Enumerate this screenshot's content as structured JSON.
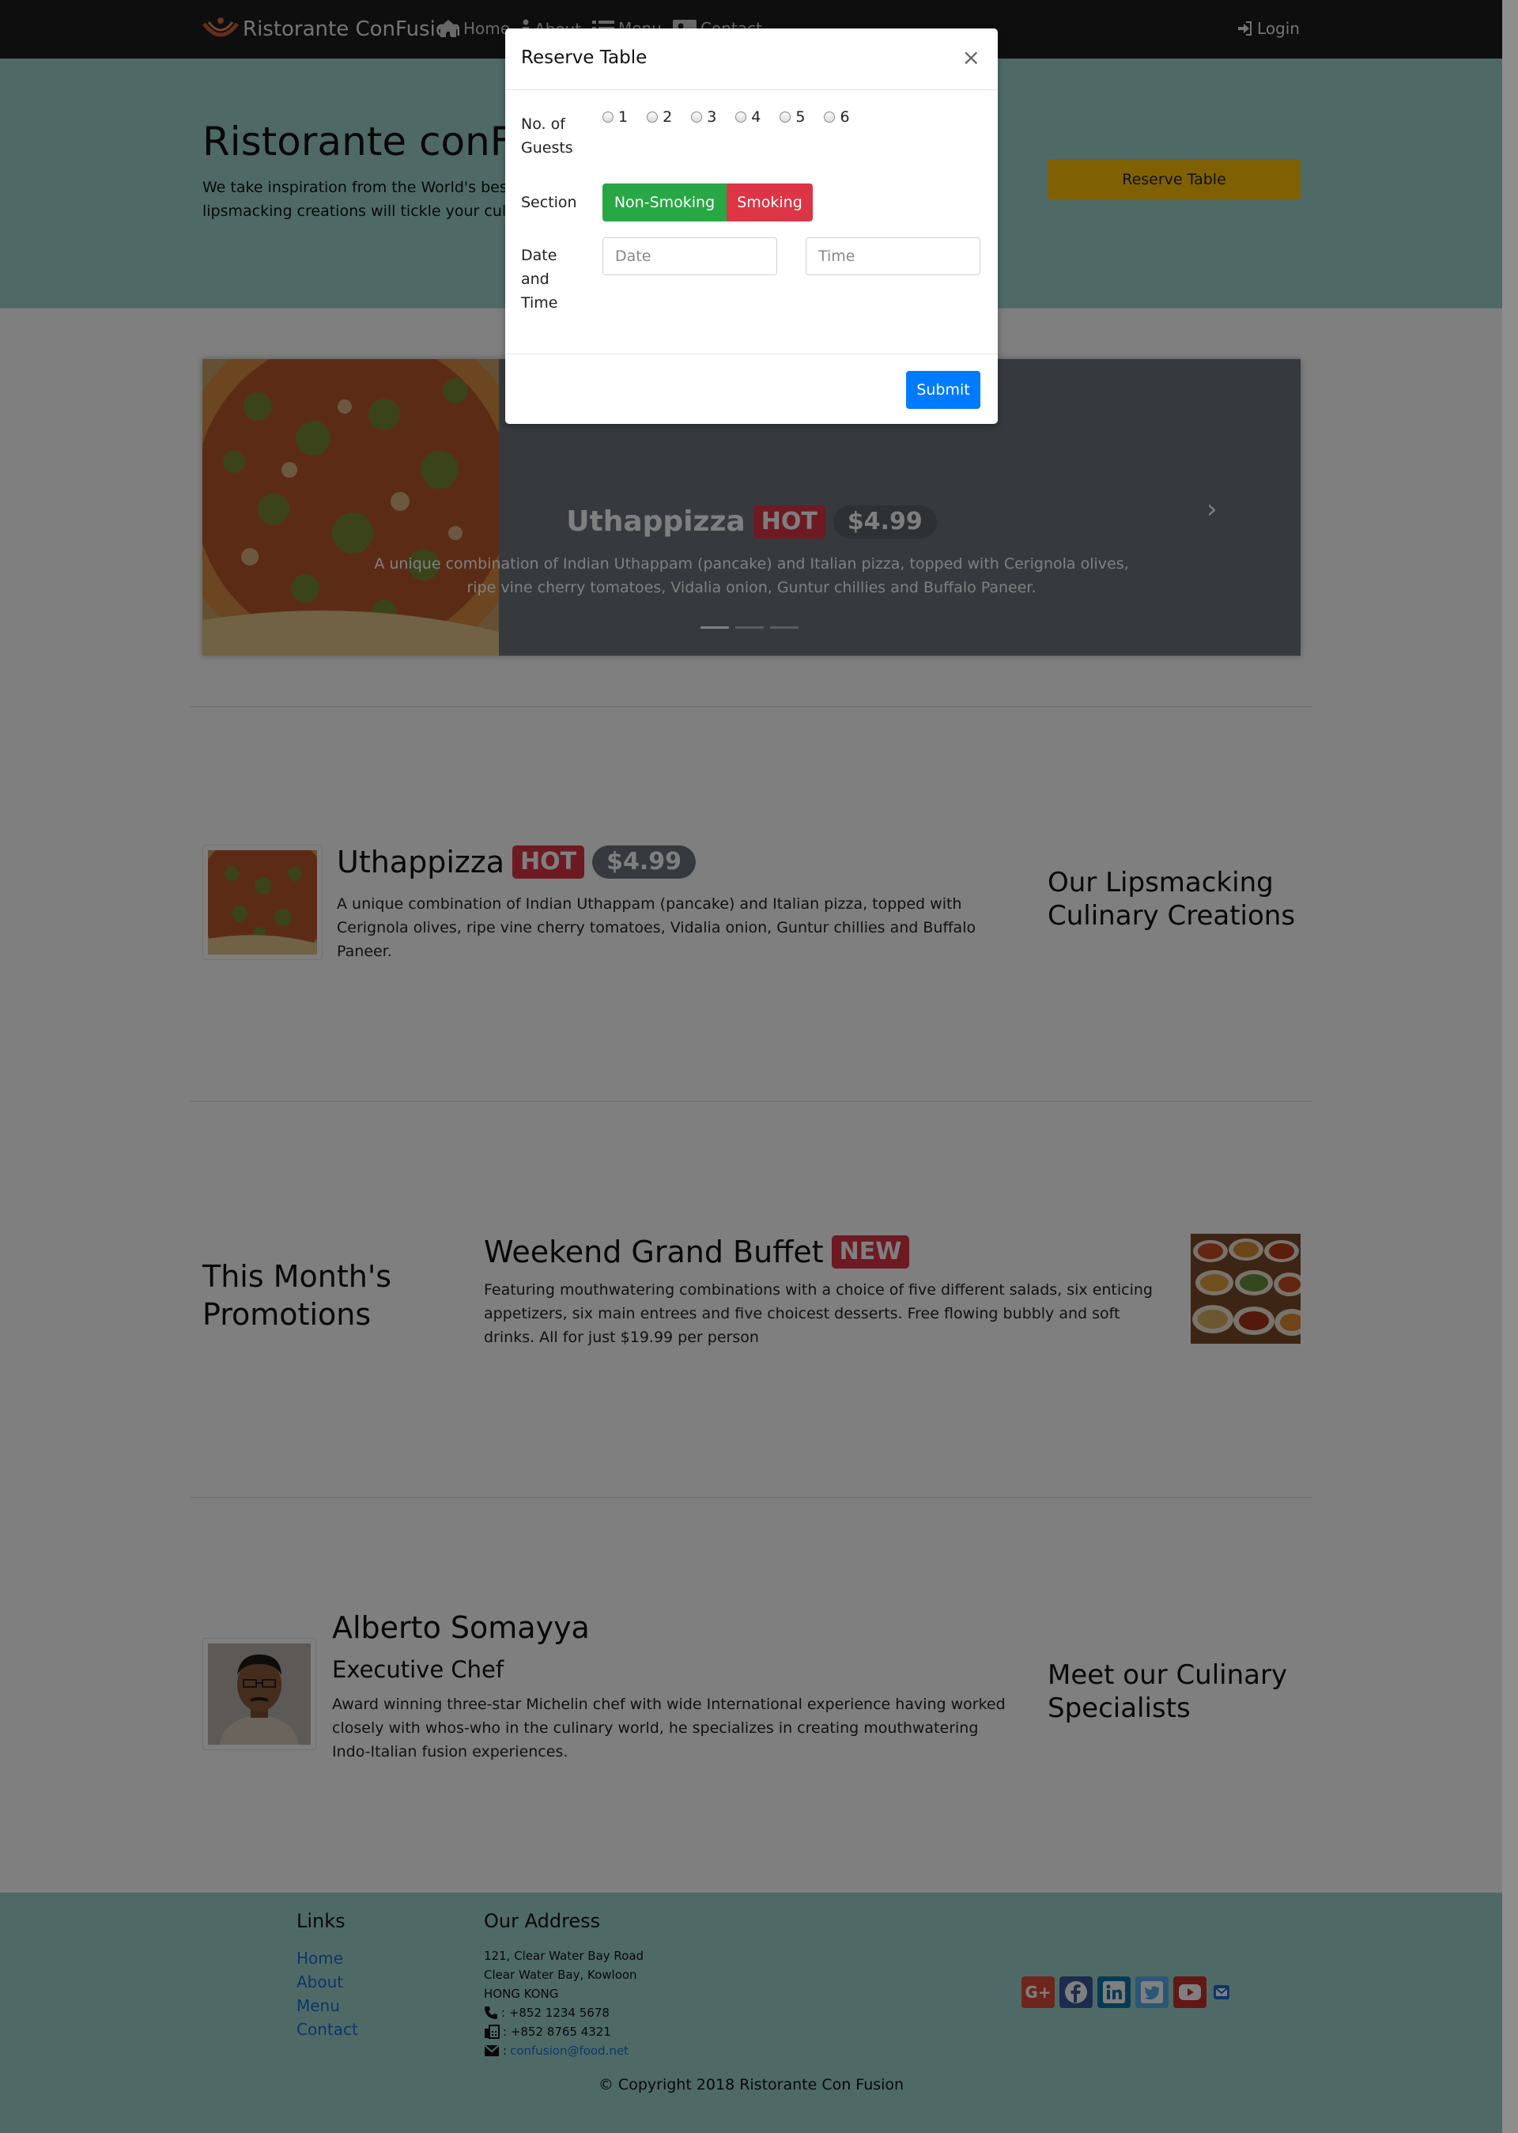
{
  "navbar": {
    "brand": "Ristorante ConFusion",
    "items": [
      {
        "label": "Home",
        "icon": "home-icon"
      },
      {
        "label": "About",
        "icon": "info-icon"
      },
      {
        "label": "Menu",
        "icon": "list-icon"
      },
      {
        "label": "Contact",
        "icon": "address-card-icon"
      }
    ],
    "login": "Login"
  },
  "jumbotron": {
    "title": "Ristorante conFusion",
    "text": "We take inspiration from the World's best cuisines, and create a unique fusion experience. Our lipsmacking creations will tickle your culinary senses!",
    "reserve_button": "Reserve Table"
  },
  "carousel": {
    "title": "Uthappizza",
    "badge": "HOT",
    "price": "$4.99",
    "description": "A unique combination of Indian Uthappam (pancake) and Italian pizza, topped with Cerignola olives, ripe vine cherry tomatoes, Vidalia onion, Guntur chillies and Buffalo Paneer.",
    "indicators": 3
  },
  "dish": {
    "title": "Uthappizza",
    "badge": "HOT",
    "price": "$4.99",
    "description": "A unique combination of Indian Uthappam (pancake) and Italian pizza, topped with Cerignola olives, ripe vine cherry tomatoes, Vidalia onion, Guntur chillies and Buffalo Paneer.",
    "side_title": "Our Lipsmacking Culinary Creations"
  },
  "promotion": {
    "side_title": "This Month's Promotions",
    "title": "Weekend Grand Buffet",
    "badge": "NEW",
    "description": "Featuring mouthwatering combinations with a choice of five different salads, six enticing appetizers, six main entrees and five choicest desserts. Free flowing bubbly and soft drinks. All for just $19.99 per person"
  },
  "leader": {
    "name": "Alberto Somayya",
    "designation": "Executive Chef",
    "description": "Award winning three-star Michelin chef with wide International experience having worked closely with whos-who in the culinary world, he specializes in creating mouthwatering Indo-Italian fusion experiences.",
    "side_title": "Meet our Culinary Specialists"
  },
  "footer": {
    "links_title": "Links",
    "links": [
      "Home",
      "About",
      "Menu",
      "Contact"
    ],
    "address_title": "Our Address",
    "address_lines": [
      "121, Clear Water Bay Road",
      "Clear Water Bay, Kowloon",
      "HONG KONG"
    ],
    "phone": ": +852 1234 5678",
    "fax": ": +852 8765 4321",
    "email_prefix": ":",
    "email": "confusion@food.net",
    "social": [
      "google-plus-icon",
      "facebook-icon",
      "linkedin-icon",
      "twitter-icon",
      "youtube-icon",
      "mail-icon"
    ],
    "copyright": "© Copyright 2018 Ristorante Con Fusion"
  },
  "modal": {
    "title": "Reserve Table",
    "close": "×",
    "guests_label": "No. of Guests",
    "guest_options": [
      "1",
      "2",
      "3",
      "4",
      "5",
      "6"
    ],
    "section_label": "Section",
    "section_options": [
      "Non-Smoking",
      "Smoking"
    ],
    "datetime_label": "Date and Time",
    "date_placeholder": "Date",
    "time_placeholder": "Time",
    "submit": "Submit"
  },
  "colors": {
    "navbar": "#1c1c1c",
    "jumbotron": "#9fd4cc",
    "accent_warning": "#ffc107",
    "success": "#28a745",
    "danger": "#dc3545",
    "primary": "#007bff"
  }
}
